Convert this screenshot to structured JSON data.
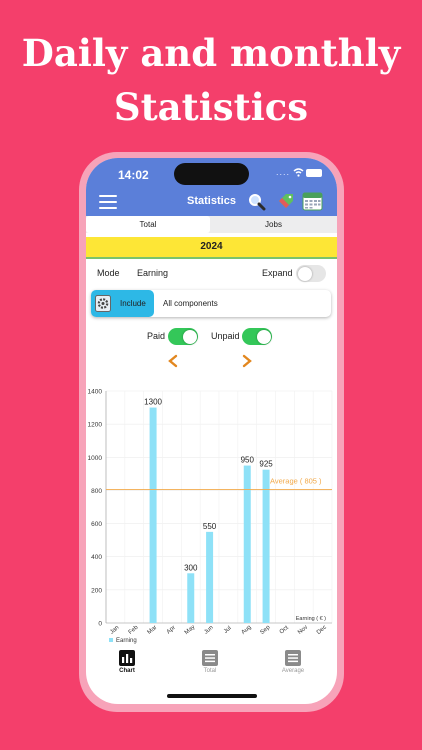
{
  "headline": {
    "line1": "Daily and monthly",
    "line2": "Statistics"
  },
  "status_bar": {
    "time": "14:02",
    "dots": "...."
  },
  "header": {
    "title": "Statistics",
    "icons": [
      "menu-icon",
      "search-icon",
      "tag-icon",
      "calendar-icon"
    ]
  },
  "tabs": [
    {
      "label": "Total",
      "selected": true
    },
    {
      "label": "Jobs",
      "selected": false
    }
  ],
  "year": "2024",
  "controls": {
    "mode_label": "Mode",
    "mode_value": "Earning",
    "expand_label": "Expand",
    "expand_on": false,
    "include_label": "Include",
    "components_label": "All components",
    "paid_label": "Paid",
    "paid_on": true,
    "unpaid_label": "Unpaid",
    "unpaid_on": true
  },
  "colors": {
    "background": "#f43f6b",
    "header": "#5b7fd9",
    "year_bar": "#fde636",
    "bar": "#8ee1f7",
    "average_line": "#f2a94a",
    "toggle_on": "#34c759",
    "include": "#2db8e6",
    "chevron": "#e2871f"
  },
  "chart_data": {
    "type": "bar",
    "categories": [
      "Jan",
      "Feb",
      "Mar",
      "Apr",
      "May",
      "Jun",
      "Jul",
      "Aug",
      "Sep",
      "Oct",
      "Nov",
      "Dec"
    ],
    "series": [
      {
        "name": "Earning",
        "values": [
          0,
          0,
          1300,
          0,
          300,
          550,
          0,
          950,
          925,
          0,
          0,
          0
        ]
      }
    ],
    "data_labels": [
      "",
      "",
      "1300",
      "",
      "300",
      "550",
      "",
      "950",
      "925",
      "",
      "",
      ""
    ],
    "yticks": [
      0,
      200,
      400,
      600,
      800,
      1000,
      1200,
      1400
    ],
    "ylim": [
      0,
      1400
    ],
    "average": 805,
    "average_label": "Average ( 805 )",
    "axis_unit_label": "Earning ( € )",
    "legend": "Earning",
    "legend_position": "bottom-left",
    "grid": true
  },
  "bottom_tabs": [
    {
      "label": "Chart",
      "selected": true,
      "icon": "bar-chart-icon"
    },
    {
      "label": "Total",
      "selected": false,
      "icon": "list-icon"
    },
    {
      "label": "Average",
      "selected": false,
      "icon": "list-icon"
    }
  ]
}
